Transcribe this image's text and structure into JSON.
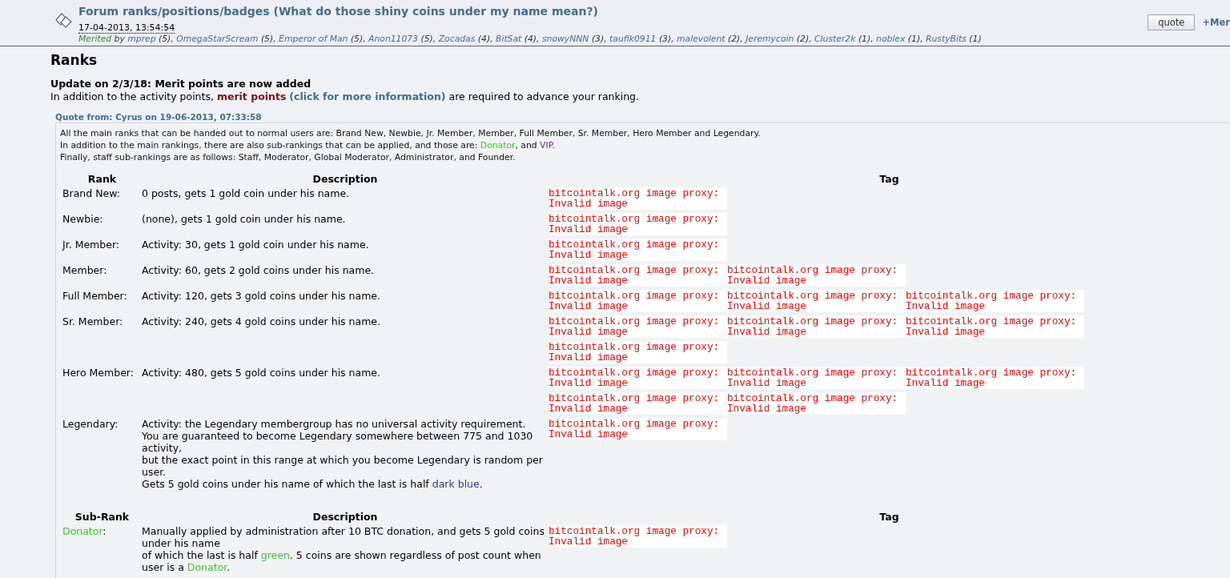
{
  "post": {
    "title": "Forum ranks/positions/badges (What do those shiny coins under my name mean?)",
    "date": "17-04-2013, 13:54:54",
    "merited_label": "Merited",
    "merited_by": "by",
    "merits": [
      {
        "name": "mprep",
        "count": "(5)"
      },
      {
        "name": "OmegaStarScream",
        "count": "(5)"
      },
      {
        "name": "Emperor of Man",
        "count": "(5)"
      },
      {
        "name": "Anon11073",
        "count": "(5)"
      },
      {
        "name": "Zocadas",
        "count": "(4)"
      },
      {
        "name": "BitSat",
        "count": "(4)"
      },
      {
        "name": "snowyNNN",
        "count": "(3)"
      },
      {
        "name": "taufik0911",
        "count": "(3)"
      },
      {
        "name": "malevolent",
        "count": "(2)"
      },
      {
        "name": "Jeremycoin",
        "count": "(2)"
      },
      {
        "name": "Cluster2k",
        "count": "(1)"
      },
      {
        "name": "noblex",
        "count": "(1)"
      },
      {
        "name": "RustyBits",
        "count": "(1)"
      }
    ],
    "separator": ",",
    "quote_button": "quote",
    "merit_button": "+Mer"
  },
  "heading": "Ranks",
  "update": {
    "title": "Update on 2/3/18: Merit points are now added",
    "before": "In addition to the activity points, ",
    "emphasis": "merit points",
    "link": "(click for more information)",
    "after": " are required to advance your ranking."
  },
  "quote": {
    "header": "Quote from: Cyrus on 19-06-2013, 07:33:58",
    "intro": [
      [
        {
          "text": "All the main ranks that can be handed out to normal users are: Brand New, Newbie, Jr. Member, Member, Full Member, Sr. Member, Hero Member and Legendary."
        }
      ],
      [
        {
          "text": "In addition to the main rankings, there are also sub-rankings that can be applied, and those are: "
        },
        {
          "text": "Donator",
          "color": "#3fc43f"
        },
        {
          "text": ", and "
        },
        {
          "text": "VIP",
          "color": "#7a2a8c"
        },
        {
          "text": "."
        }
      ],
      [
        {
          "text": "Finally, staff sub-rankings are as follows: Staff, Moderator, Global Moderator, Administrator, and Founder."
        }
      ]
    ],
    "tables": [
      {
        "columns": [
          "Rank",
          "Description",
          "Tag"
        ],
        "rows": [
          {
            "rank": [
              {
                "text": "Brand New:"
              }
            ],
            "description": [
              [
                {
                  "text": "0 posts, gets 1 gold coin under his name."
                }
              ]
            ],
            "tags": [
              "bitcointalk.org image proxy:\nInvalid image"
            ]
          },
          {
            "rank": [
              {
                "text": "Newbie:"
              }
            ],
            "description": [
              [
                {
                  "text": "(none), gets 1 gold coin under his name."
                }
              ]
            ],
            "tags": [
              "bitcointalk.org image proxy:\nInvalid image"
            ]
          },
          {
            "rank": [
              {
                "text": "Jr. Member:"
              }
            ],
            "description": [
              [
                {
                  "text": "Activity: 30, gets 1 gold coin under his name."
                }
              ]
            ],
            "tags": [
              "bitcointalk.org image proxy:\nInvalid image"
            ]
          },
          {
            "rank": [
              {
                "text": "Member:"
              }
            ],
            "description": [
              [
                {
                  "text": "Activity: 60, gets 2 gold coins under his name."
                }
              ]
            ],
            "tags": [
              "bitcointalk.org image proxy:\nInvalid image",
              "bitcointalk.org image proxy:\nInvalid image"
            ]
          },
          {
            "rank": [
              {
                "text": "Full Member:"
              }
            ],
            "description": [
              [
                {
                  "text": "Activity: 120, gets 3 gold coins under his name."
                }
              ]
            ],
            "tags": [
              "bitcointalk.org image proxy:\nInvalid image",
              "bitcointalk.org image proxy:\nInvalid image",
              "bitcointalk.org image proxy:\nInvalid image"
            ]
          },
          {
            "rank": [
              {
                "text": "Sr. Member:"
              }
            ],
            "description": [
              [
                {
                  "text": "Activity: 240, gets 4 gold coins under his name."
                }
              ]
            ],
            "tags": [
              "bitcointalk.org image proxy:\nInvalid image",
              "bitcointalk.org image proxy:\nInvalid image",
              "bitcointalk.org image proxy:\nInvalid image",
              "bitcointalk.org image proxy:\nInvalid image"
            ]
          },
          {
            "rank": [
              {
                "text": "Hero Member:"
              }
            ],
            "description": [
              [
                {
                  "text": "Activity: 480, gets 5 gold coins under his name."
                }
              ]
            ],
            "tags": [
              "bitcointalk.org image proxy:\nInvalid image",
              "bitcointalk.org image proxy:\nInvalid image",
              "bitcointalk.org image proxy:\nInvalid image",
              "bitcointalk.org image proxy:\nInvalid image",
              "bitcointalk.org image proxy:\nInvalid image"
            ]
          },
          {
            "rank": [
              {
                "text": "Legendary:"
              }
            ],
            "description": [
              [
                {
                  "text": "Activity: the Legendary membergroup has no universal activity requirement."
                }
              ],
              [
                {
                  "text": "You are guaranteed to become Legendary somewhere between 775 and 1030 activity,"
                }
              ],
              [
                {
                  "text": "but the exact point in this range at which you become Legendary is random per user."
                }
              ],
              [
                {
                  "text": "Gets 5 gold coins under his name of which the last is half "
                },
                {
                  "text": "dark blue",
                  "color": "#37368a"
                },
                {
                  "text": "."
                }
              ]
            ],
            "tags": [
              "bitcointalk.org image proxy:\nInvalid image"
            ]
          }
        ]
      },
      {
        "columns": [
          "Sub-Rank",
          "Description",
          "Tag"
        ],
        "rows": [
          {
            "rank": [
              {
                "text": "Donator",
                "color": "#3fc43f"
              },
              {
                "text": ":"
              }
            ],
            "description": [
              [
                {
                  "text": "Manually applied by administration after 10 BTC donation, and gets 5 gold coins under his name"
                }
              ],
              [
                {
                  "text": "of which the last is half "
                },
                {
                  "text": "green",
                  "color": "#3fc43f"
                },
                {
                  "text": ". 5 coins are shown regardless of post count when user is a "
                },
                {
                  "text": "Donator",
                  "color": "#3fc43f"
                },
                {
                  "text": "."
                }
              ]
            ],
            "tags": [
              "bitcointalk.org image proxy:\nInvalid image"
            ]
          }
        ]
      }
    ]
  }
}
